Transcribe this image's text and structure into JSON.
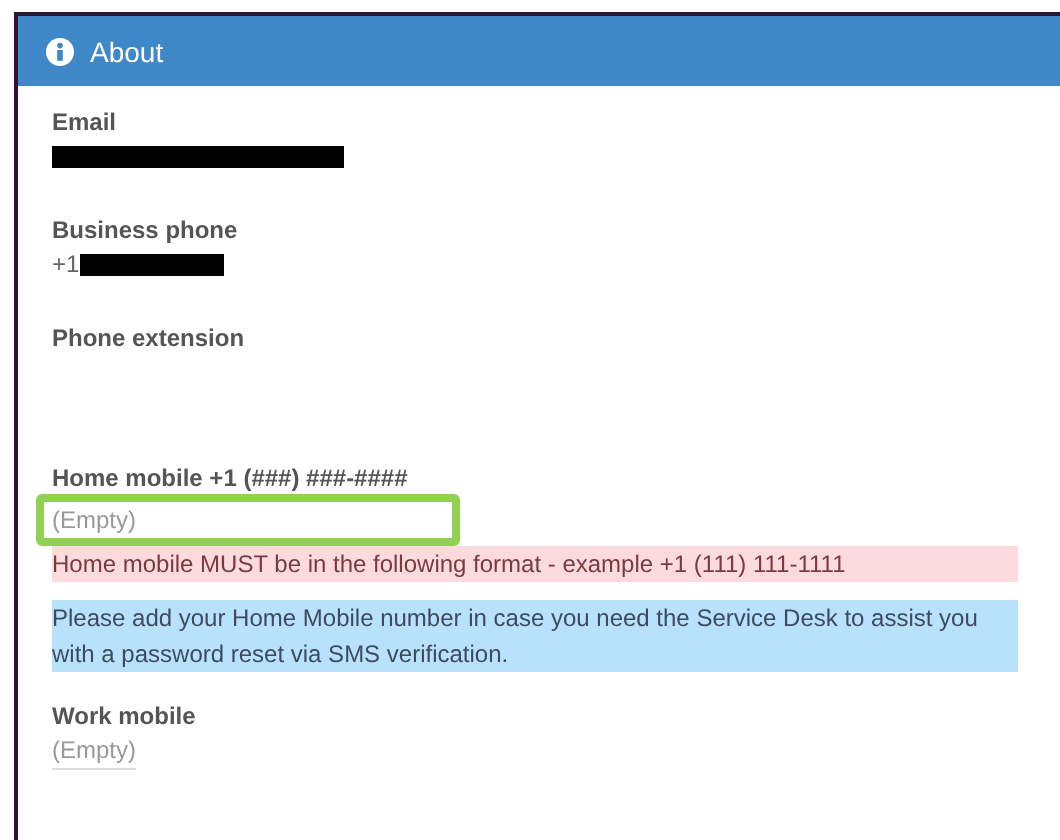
{
  "panel": {
    "title": "About"
  },
  "fields": [
    {
      "label": "Email",
      "redacted": true
    },
    {
      "label": "Business phone",
      "value": "+1",
      "redacted": true
    },
    {
      "label": "Phone extension"
    },
    {
      "label": "Home mobile +1 (###) ###-####",
      "placeholder": "(Empty)",
      "highlighted": true,
      "messages": [
        {
          "kind": "error",
          "text": "Home mobile MUST be in the following format - example +1 (111) 111-1111"
        },
        {
          "kind": "info",
          "text": "Please add your Home Mobile number in case you need the Service Desk to assist you with a password reset via SMS verification."
        }
      ]
    },
    {
      "label": "Work mobile",
      "placeholder": "(Empty)",
      "highlighted": false
    }
  ]
}
